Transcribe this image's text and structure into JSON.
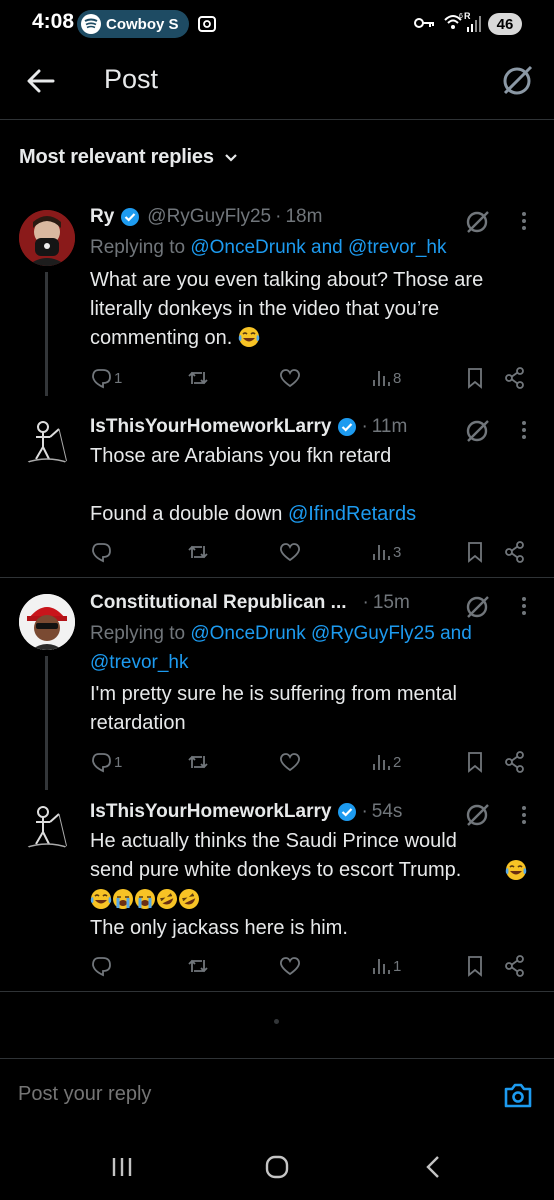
{
  "status_bar": {
    "time": "4:08",
    "media_label": "Cowboy S",
    "battery": "46",
    "signal_label": "R",
    "wifi_label": "6"
  },
  "header": {
    "title": "Post",
    "back_icon": "arrow-left-icon",
    "grok_icon": "grok-icon"
  },
  "sort": {
    "label": "Most relevant replies"
  },
  "replies": [
    {
      "name": "Ry",
      "handle": "@RyGuyFly25",
      "time": "18m",
      "replying_prefix": "Replying to",
      "replying_to": "@OnceDrunk and @trevor_hk",
      "body": "What are you even talking about? Those are literally donkeys in the video that you’re commenting on.",
      "reply_count": "1",
      "views": "8"
    },
    {
      "name": "IsThisYourHomeworkLarry",
      "handle": "",
      "time": "11m",
      "body_line1": "Those are Arabians you fkn retard",
      "body_line2_text": "Found a double down",
      "body_line2_mention": "@IfindRetards",
      "reply_count": "",
      "views": "3"
    },
    {
      "name": "Constitutional Republican ...",
      "handle": "",
      "time": "15m",
      "replying_prefix": "Replying to",
      "replying_to_line1": "@OnceDrunk @RyGuyFly25 and",
      "replying_to_line2": "@trevor_hk",
      "body": "I'm pretty sure he is suffering from mental retardation",
      "reply_count": "1",
      "views": "2"
    },
    {
      "name": "IsThisYourHomeworkLarry",
      "handle": "",
      "time": "54s",
      "body_line1": "He actually thinks the Saudi Prince would send pure white donkeys to escort Trump.",
      "body_line2": "The only jackass here is him.",
      "reply_count": "",
      "views": "1"
    }
  ],
  "composer": {
    "placeholder": "Post your reply"
  },
  "colors": {
    "accent": "#1d9bf0",
    "muted": "#71767b",
    "background": "#000000"
  }
}
